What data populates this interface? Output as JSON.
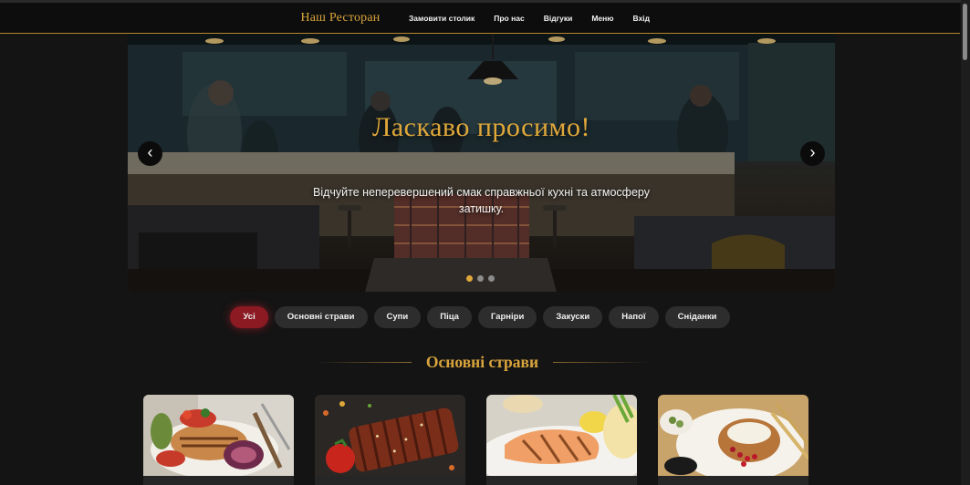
{
  "nav": {
    "brand": "Наш Ресторан",
    "links": [
      "Замовити столик",
      "Про нас",
      "Відгуки",
      "Меню",
      "Вхід"
    ]
  },
  "hero": {
    "title": "Ласкаво просимо!",
    "subtitle": "Відчуйте неперевершений смак справжньої кухні та атмосферу затишку.",
    "prev_icon": "‹",
    "next_icon": "›",
    "slides_count": 3,
    "active_slide": 1
  },
  "filters": {
    "items": [
      "Усі",
      "Основні страви",
      "Супи",
      "Піца",
      "Гарніри",
      "Закуски",
      "Напої",
      "Сніданки"
    ],
    "active": "Усі"
  },
  "section": {
    "title": "Основні страви"
  },
  "cards": [
    {
      "image": "grilled-chicken-plate"
    },
    {
      "image": "glazed-ribs"
    },
    {
      "image": "grilled-salmon"
    },
    {
      "image": "baked-potato-pomegranate"
    }
  ],
  "colors": {
    "accent": "#d9a53c",
    "active_chip": "#8c1a23",
    "background": "#141414"
  }
}
